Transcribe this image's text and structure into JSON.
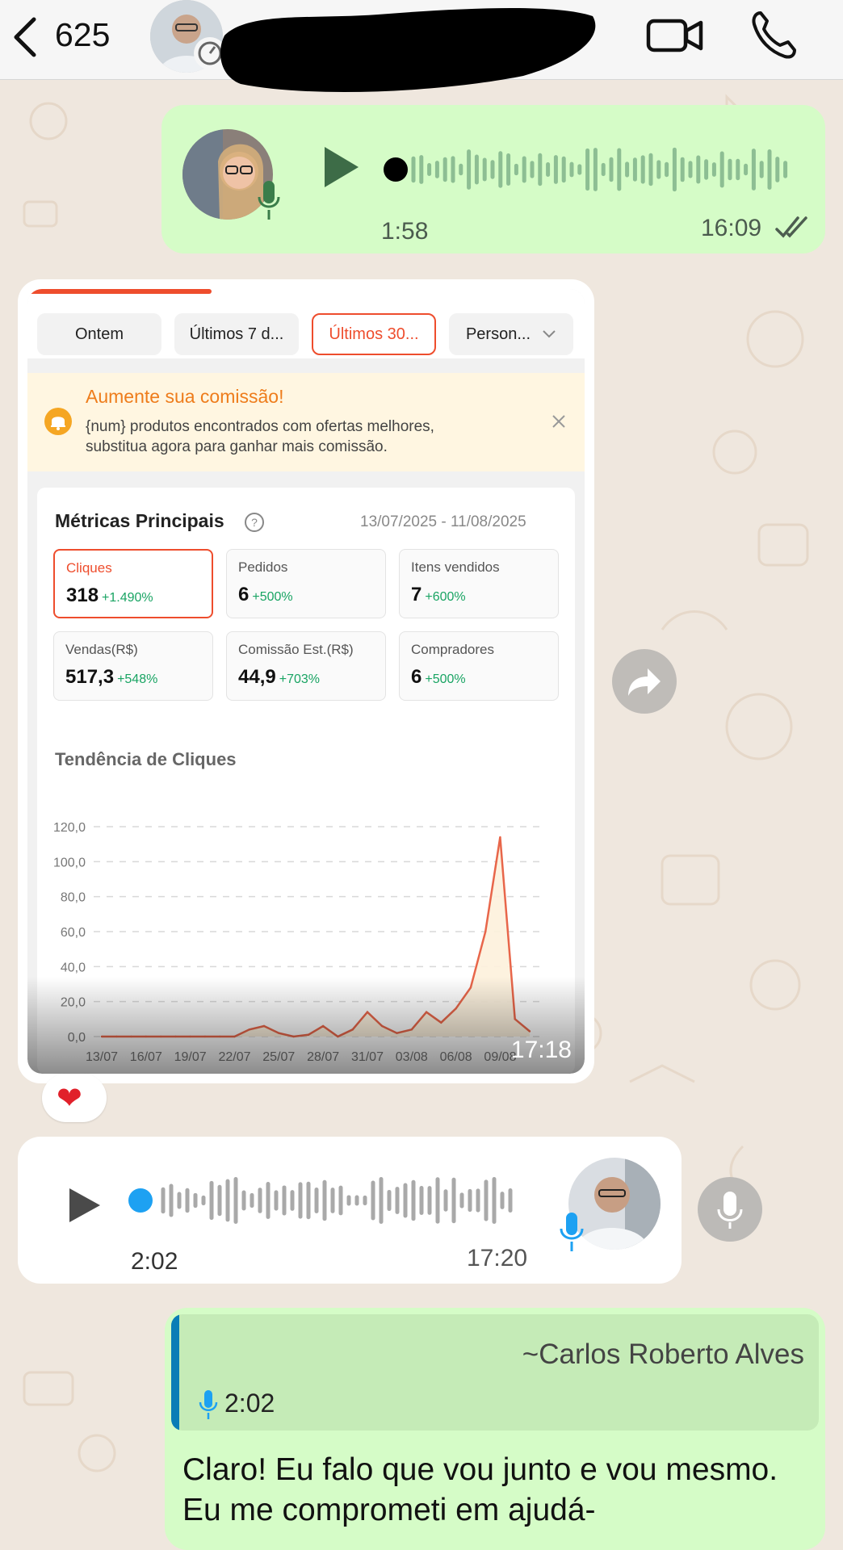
{
  "header": {
    "unread_count": "625",
    "icons": {
      "back": "chevron-left-icon",
      "video": "video-camera-icon",
      "call": "phone-icon"
    }
  },
  "messages": {
    "voice_out": {
      "duration": "1:58",
      "time": "16:09",
      "status": "read-double-check"
    },
    "screenshot": {
      "time": "17:18",
      "reaction": "❤",
      "tabs": [
        {
          "label": "Ontem"
        },
        {
          "label": "Últimos 7 d..."
        },
        {
          "label": "Últimos 30..."
        },
        {
          "label": "Person..."
        }
      ],
      "active_tab": "Últimos 30...",
      "banner": {
        "title": "Aumente sua comissão!",
        "text": "{num} produtos encontrados com ofertas melhores, substitua agora para ganhar mais comissão."
      },
      "metrics_title": "Métricas Principais",
      "date_range": "13/07/2025 - 11/08/2025",
      "metrics": [
        {
          "label": "Cliques",
          "value": "318",
          "change": "+1.490%"
        },
        {
          "label": "Pedidos",
          "value": "6",
          "change": "+500%"
        },
        {
          "label": "Itens vendidos",
          "value": "7",
          "change": "+600%"
        },
        {
          "label": "Vendas(R$)",
          "value": "517,3",
          "change": "+548%"
        },
        {
          "label": "Comissão Est.(R$)",
          "value": "44,9",
          "change": "+703%"
        },
        {
          "label": "Compradores",
          "value": "6",
          "change": "+500%"
        }
      ],
      "trend_title": "Tendência de Cliques",
      "chart_data": {
        "type": "area",
        "title": "Tendência de Cliques",
        "y_ticks": [
          "0,0",
          "20,0",
          "40,0",
          "60,0",
          "80,0",
          "100,0",
          "120,0"
        ],
        "ylim": [
          0,
          120
        ],
        "x_tick_labels": [
          "13/07",
          "16/07",
          "19/07",
          "22/07",
          "25/07",
          "28/07",
          "31/07",
          "03/08",
          "06/08",
          "09/08"
        ],
        "grid": true,
        "series": [
          {
            "color": "#e8664a",
            "values": [
              0,
              0,
              0,
              0,
              0,
              0,
              0,
              0,
              0,
              0,
              4,
              6,
              2,
              0,
              1,
              6,
              0,
              4,
              14,
              6,
              2,
              4,
              14,
              8,
              16,
              28,
              60,
              114,
              10,
              3
            ]
          }
        ]
      }
    },
    "voice_in": {
      "duration": "2:02",
      "time": "17:20"
    },
    "reply": {
      "quoted_author": "~Carlos Roberto Alves",
      "quoted_duration": "2:02",
      "text": "Claro! Eu falo que vou junto e vou mesmo. Eu me comprometi em ajudá-"
    }
  },
  "colors": {
    "outgoing_bubble": "#d5fcc7",
    "incoming_bubble": "#ffffff",
    "accent": "#ee4d2d",
    "positive": "#19a463"
  }
}
